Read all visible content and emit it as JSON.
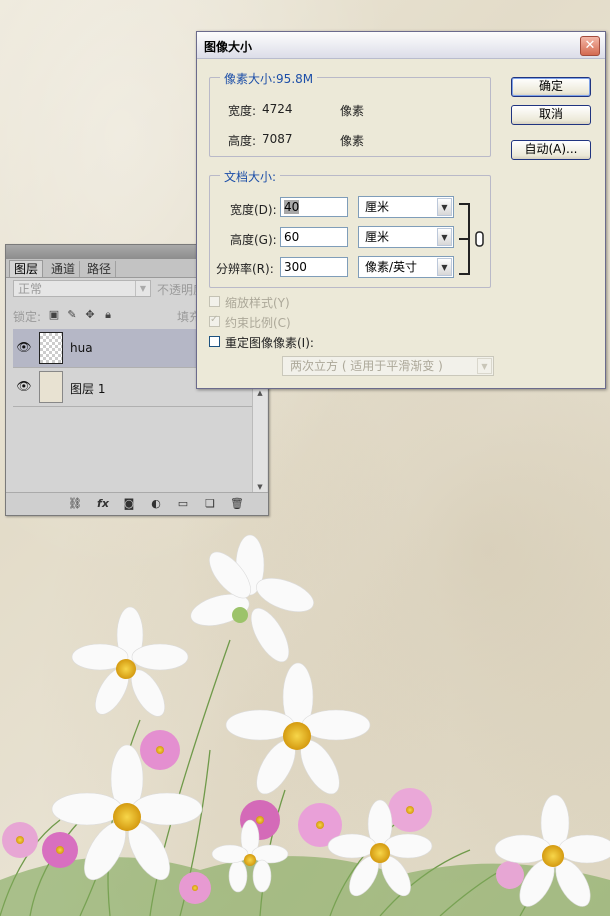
{
  "layers_panel": {
    "tabs": [
      {
        "label": "图层"
      },
      {
        "label": "通道"
      },
      {
        "label": "路径"
      }
    ],
    "blend_mode": "正常",
    "opacity_label": "不透明度",
    "lock_label": "锁定:",
    "fill_label": "填充",
    "layers": [
      {
        "name": "hua",
        "visible": true,
        "selected": true
      },
      {
        "name": "图层 1",
        "visible": true,
        "selected": false
      }
    ],
    "bottom_icons": [
      "link-icon",
      "fx-icon",
      "mask-icon",
      "adjustment-icon",
      "folder-icon",
      "new-layer-icon",
      "trash-icon"
    ]
  },
  "dialog": {
    "title": "图像大小",
    "pixel_dimensions": {
      "title": "像素大小:95.8M",
      "width_label": "宽度:",
      "width_value": "4724",
      "width_unit": "像素",
      "height_label": "高度:",
      "height_value": "7087",
      "height_unit": "像素"
    },
    "document_size": {
      "title": "文档大小:",
      "width_label": "宽度(D):",
      "width_value": "40",
      "width_unit": "厘米",
      "height_label": "高度(G):",
      "height_value": "60",
      "height_unit": "厘米",
      "resolution_label": "分辨率(R):",
      "resolution_value": "300",
      "resolution_unit": "像素/英寸"
    },
    "buttons": {
      "ok": "确定",
      "cancel": "取消",
      "auto": "自动(A)..."
    },
    "options": {
      "scale_styles": "缩放样式(Y)",
      "constrain": "约束比例(C)",
      "resample": "重定图像像素(I):",
      "resample_method": "两次立方 ( 适用于平滑渐变 )"
    }
  },
  "colors": {
    "group_title": "#1d4fa8",
    "dialog_bg": "#ece9d8",
    "selected_layer": "#b5b7c6"
  }
}
